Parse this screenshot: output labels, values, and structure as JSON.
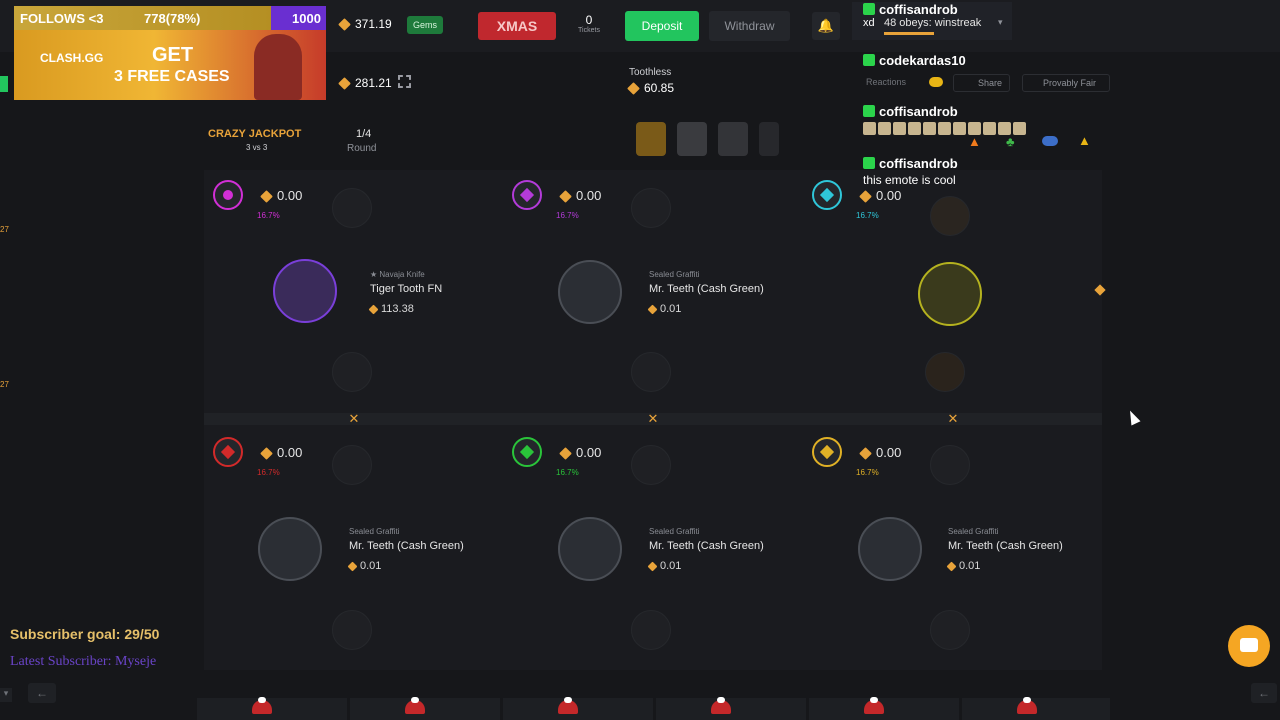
{
  "overlay": {
    "follows_label": "FOLLOWS <3",
    "follows_count": "778(78%)",
    "follows_goal": "1000",
    "ad_brand": "CLASH.GG",
    "ad_line1": "GET",
    "ad_line2": "3 FREE CASES",
    "subscriber_goal": "Subscriber goal: 29/50",
    "latest_subscriber": "Latest Subscriber: Myseje"
  },
  "header": {
    "balance": "371.19",
    "gems_label": "Gems",
    "xmas_label": "XMAS",
    "tickets_count": "0",
    "tickets_label": "Tickets",
    "deposit_label": "Deposit",
    "withdraw_label": "Withdraw",
    "secondary_balance": "281.21"
  },
  "game": {
    "mode_title": "CRAZY JACKPOT",
    "mode_sub": "3 vs 3",
    "round": "1/4",
    "round_label": "Round",
    "player_name": "Toothless",
    "player_value": "60.85",
    "reactions_label": "Reactions",
    "share_label": "Share",
    "fair_label": "Provably Fair",
    "players": [
      {
        "value": "0.00",
        "pct": "16.7%",
        "color": "#d12fd6",
        "item_cat": "★ Navaja Knife",
        "item_name": "Tiger Tooth FN",
        "item_price": "113.38"
      },
      {
        "value": "0.00",
        "pct": "16.7%",
        "color": "#b33bd9",
        "item_cat": "Sealed Graffiti",
        "item_name": "Mr. Teeth (Cash Green)",
        "item_price": "0.01"
      },
      {
        "value": "0.00",
        "pct": "16.7%",
        "color": "#2fc6d9",
        "item_cat": "",
        "item_name": "",
        "item_price": ""
      },
      {
        "value": "0.00",
        "pct": "16.7%",
        "color": "#d22a2a",
        "item_cat": "Sealed Graffiti",
        "item_name": "Mr. Teeth (Cash Green)",
        "item_price": "0.01"
      },
      {
        "value": "0.00",
        "pct": "16.7%",
        "color": "#2ac43a",
        "item_cat": "Sealed Graffiti",
        "item_name": "Mr. Teeth (Cash Green)",
        "item_price": "0.01"
      },
      {
        "value": "0.00",
        "pct": "16.7%",
        "color": "#e0b126",
        "item_cat": "Sealed Graffiti",
        "item_name": "Mr. Teeth (Cash Green)",
        "item_price": "0.01"
      }
    ]
  },
  "chat": {
    "m1_user": "coffisandrob",
    "m1_sub": "48 obeys: winstreak",
    "m1_prefix": "xd",
    "m2_user": "codekardas10",
    "m3_user": "coffisandrob",
    "m4_user": "coffisandrob",
    "m4_text": "this emote is cool"
  },
  "side": {
    "left_a": "27",
    "left_b": "27"
  },
  "colors": {
    "accent": "#e8a33a",
    "deposit": "#22c55e",
    "chat_button": "#f5a623"
  }
}
